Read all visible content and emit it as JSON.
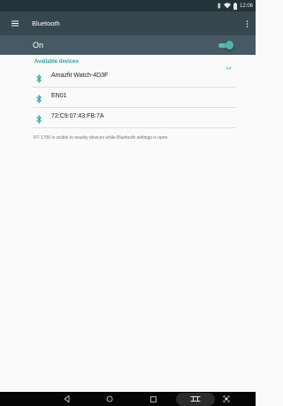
{
  "status_bar": {
    "time": "12:06",
    "icons": [
      "bluetooth-icon",
      "wifi-icon",
      "battery-icon"
    ]
  },
  "toolbar": {
    "title": "Bluetooth",
    "menu_icon": "hamburger-menu-icon",
    "overflow_icon": "overflow-menu-icon"
  },
  "switch_bar": {
    "label": "On",
    "state": true,
    "accent_color": "#4db6ac"
  },
  "available_devices": {
    "header": "Available devices",
    "devices": [
      {
        "name": "Amazfit Watch-4D3F",
        "icon": "bluetooth-icon"
      },
      {
        "name": "EN01",
        "icon": "bluetooth-icon"
      },
      {
        "name": "72:C9:07:43:FB:7A",
        "icon": "bluetooth-icon"
      }
    ]
  },
  "footer_note": "RT-1706 is visible to nearby devices while Bluetooth settings is open.",
  "nav_bar": {
    "buttons": [
      "back-icon",
      "home-icon",
      "recents-icon",
      "split-screen-icon",
      "screenshot-icon"
    ]
  },
  "colors": {
    "status_bar": "#243239",
    "toolbar": "#37474f",
    "switch_bar": "#455a64",
    "accent": "#26a69a"
  }
}
